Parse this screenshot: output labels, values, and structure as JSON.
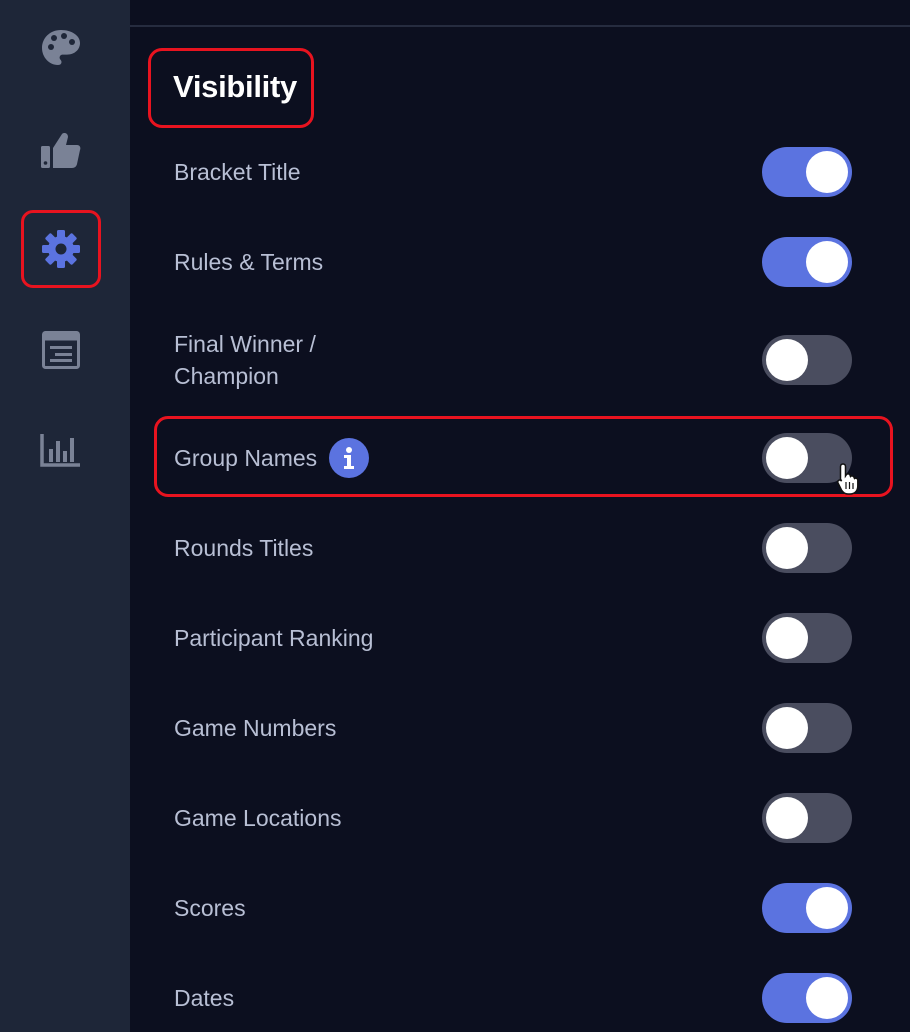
{
  "sidebar": {
    "items": [
      {
        "icon": "palette-icon",
        "active": false
      },
      {
        "icon": "thumbs-up-icon",
        "active": false
      },
      {
        "icon": "gear-icon",
        "active": true
      },
      {
        "icon": "browser-window-icon",
        "active": false
      },
      {
        "icon": "bar-chart-icon",
        "active": false
      }
    ]
  },
  "section": {
    "title": "Visibility"
  },
  "settings": [
    {
      "label": "Bracket Title",
      "enabled": true
    },
    {
      "label": "Rules & Terms",
      "enabled": true
    },
    {
      "label": "Final Winner / Champion",
      "enabled": false
    },
    {
      "label": "Group Names",
      "enabled": false,
      "has_info": true,
      "info_icon": "info-icon"
    },
    {
      "label": "Rounds Titles",
      "enabled": false
    },
    {
      "label": "Participant Ranking",
      "enabled": false
    },
    {
      "label": "Game Numbers",
      "enabled": false
    },
    {
      "label": "Game Locations",
      "enabled": false
    },
    {
      "label": "Scores",
      "enabled": true
    },
    {
      "label": "Dates",
      "enabled": true
    }
  ],
  "colors": {
    "accent": "#5b73e0",
    "highlight": "#e8131f",
    "toggle_off": "#4a4d5f",
    "sidebar_bg": "#1e2638",
    "main_bg": "#0c0f1f",
    "sidebar_icon": "#7a8296"
  }
}
